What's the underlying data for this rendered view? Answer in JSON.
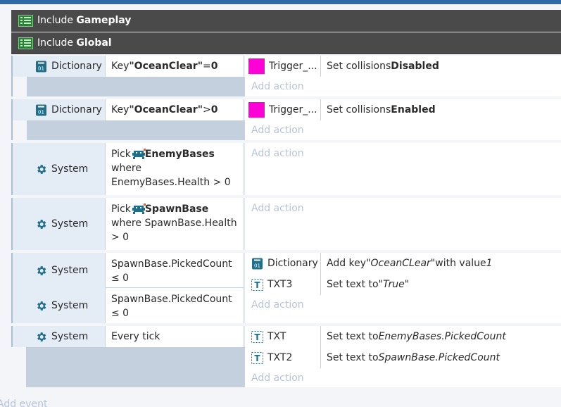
{
  "includes": [
    {
      "prefix": "Include ",
      "name": "Gameplay"
    },
    {
      "prefix": "Include ",
      "name": "Global"
    }
  ],
  "events": {
    "e1": {
      "cond_object": "Dictionary",
      "cond_pre": "Key ",
      "cond_key": "\"OceanClear\"",
      "cond_op": " = ",
      "cond_val": "0",
      "act_object": "Trigger_...",
      "act_pre": "Set collisions ",
      "act_val": "Disabled",
      "add_action": "Add action"
    },
    "e2": {
      "cond_object": "Dictionary",
      "cond_pre": "Key ",
      "cond_key": "\"OceanClear\"",
      "cond_op": " > ",
      "cond_val": "0",
      "act_object": "Trigger_...",
      "act_pre": "Set collisions ",
      "act_val": "Enabled",
      "add_action": "Add action"
    },
    "e3": {
      "cond_object": "System",
      "pick": "Pick ",
      "pick_obj": "EnemyBases",
      "where": "where EnemyBases.Health > 0",
      "add_action": "Add action"
    },
    "e4": {
      "cond_object": "System",
      "pick": "Pick ",
      "pick_obj": "SpawnBase",
      "where": "where SpawnBase.Health > 0",
      "add_action": "Add action"
    },
    "e5": {
      "cond1_object": "System",
      "cond1_text": "SpawnBase.PickedCount ≤ 0",
      "cond2_object": "System",
      "cond2_text": "SpawnBase.PickedCount ≤ 0",
      "act1_object": "Dictionary",
      "act1_pre": "Add key ",
      "act1_key": "\"OceanCLear\"",
      "act1_mid": " with value ",
      "act1_val": "1",
      "act2_object": "TXT3",
      "act2_pre": "Set text to ",
      "act2_val": "\"True\"",
      "add_action": "Add action"
    },
    "e6": {
      "cond_object": "System",
      "cond_text": "Every tick",
      "act1_object": "TXT",
      "act1_pre": "Set text to ",
      "act1_val": "EnemyBases.PickedCount",
      "act2_object": "TXT2",
      "act2_pre": "Set text to ",
      "act2_val": "SpawnBase.PickedCount",
      "add_action": "Add action"
    }
  },
  "footer": {
    "add_event": "Add event"
  },
  "colors": {
    "accent": "#2e6aa8",
    "include_bg": "#4a4a4a",
    "trigger": "#ff00d6",
    "icon_teal": "#1f6f8b"
  }
}
